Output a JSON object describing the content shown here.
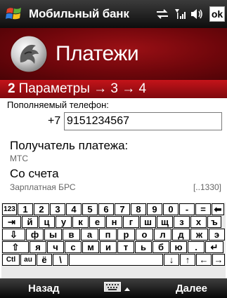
{
  "statusbar": {
    "app_title": "Мобильный банк",
    "ok_label": "ok",
    "icons": [
      "windows-start-icon",
      "sync-icon",
      "signal-icon",
      "speaker-icon"
    ]
  },
  "header": {
    "title": "Платежи",
    "logo_icon": "bank-logo-icon"
  },
  "steps": {
    "current": "2",
    "label": "Параметры → 3 → 4"
  },
  "form": {
    "phone_label": "Пополняемый телефон:",
    "phone_prefix": "+7",
    "phone_value": "9151234567",
    "recipient_label": "Получатель платежа:",
    "recipient_value": "МТС",
    "account_label": "Со счета",
    "account_value": "Зарплатная БРС",
    "account_number": "[..1330]"
  },
  "keyboard": {
    "rows": [
      [
        "123",
        "1",
        "2",
        "3",
        "4",
        "5",
        "6",
        "7",
        "8",
        "9",
        "0",
        "-",
        "=",
        "⬅"
      ],
      [
        "⇥",
        "й",
        "ц",
        "у",
        "к",
        "е",
        "н",
        "г",
        "ш",
        "щ",
        "з",
        "х",
        "ъ"
      ],
      [
        "⇩",
        "ф",
        "ы",
        "в",
        "а",
        "п",
        "р",
        "о",
        "л",
        "д",
        "ж",
        "э"
      ],
      [
        "⇧",
        "я",
        "ч",
        "с",
        "м",
        "и",
        "т",
        "ь",
        "б",
        "ю",
        ".",
        "↵"
      ],
      [
        "Ctl",
        "au",
        "ё",
        "\\",
        "",
        "↓",
        "↑",
        "←",
        "→"
      ]
    ]
  },
  "bottombar": {
    "left_label": "Назад",
    "right_label": "Далее",
    "center_icon": "keyboard-icon"
  },
  "colors": {
    "header_red": "#8a0a0f",
    "steps_red": "#b01016",
    "bar_dark": "#1a1a1a"
  }
}
